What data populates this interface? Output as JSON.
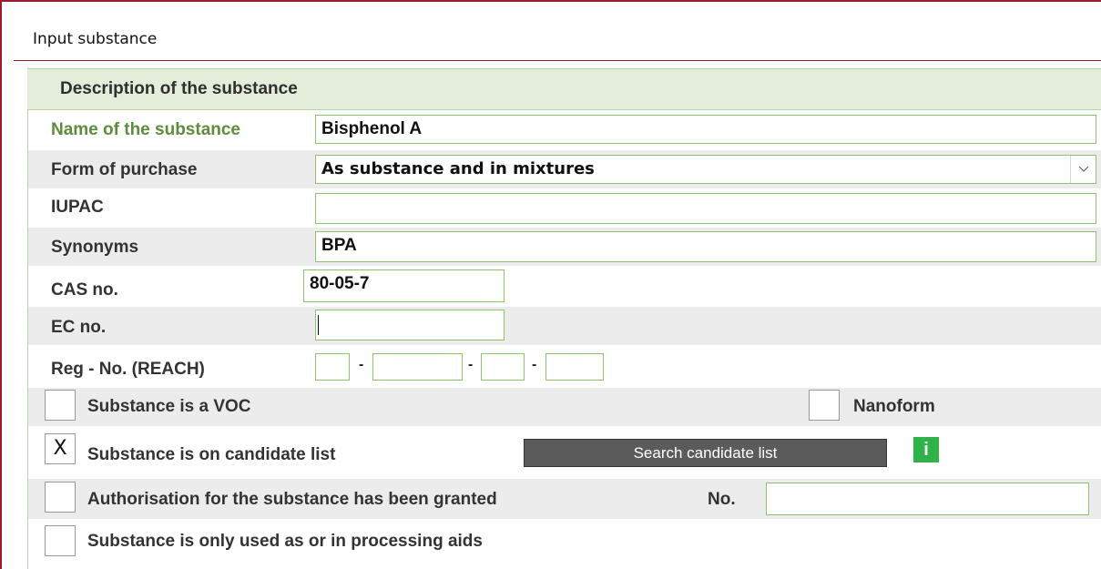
{
  "window": {
    "title": "Input substance"
  },
  "section": {
    "title": "Description of the substance"
  },
  "fields": {
    "name": {
      "label": "Name of the substance",
      "value": "Bisphenol A"
    },
    "form": {
      "label": "Form of purchase",
      "value": "As substance and in mixtures"
    },
    "iupac": {
      "label": "IUPAC",
      "value": ""
    },
    "synonyms": {
      "label": "Synonyms",
      "value": "BPA"
    },
    "cas": {
      "label": "CAS no.",
      "value": "80-05-7"
    },
    "ec": {
      "label": "EC no.",
      "value": ""
    },
    "reg": {
      "label": "Reg - No. (REACH)",
      "separator": "-",
      "parts": [
        "",
        "",
        "",
        ""
      ]
    }
  },
  "checkboxes": {
    "voc": {
      "label": "Substance is a VOC",
      "checked": false,
      "mark": ""
    },
    "nanoform": {
      "label": "Nanoform",
      "checked": false,
      "mark": ""
    },
    "candidate": {
      "label": "Substance is on candidate list",
      "checked": true,
      "mark": "X"
    },
    "authorisation": {
      "label": "Authorisation for the substance has been granted",
      "checked": false,
      "mark": ""
    },
    "processing": {
      "label": "Substance is only used as or in processing aids",
      "checked": false,
      "mark": ""
    }
  },
  "authorisation_no": {
    "label": "No.",
    "value": ""
  },
  "buttons": {
    "search_candidate": "Search candidate list"
  },
  "info": {
    "glyph": "i",
    "icon": "info-icon"
  },
  "colors": {
    "frame": "#9b1c2a",
    "header_bg": "#e3edd9",
    "field_border": "#8cc46c",
    "label_green": "#5c8c3c",
    "button_bg": "#5b5b5b",
    "info_bg": "#2fb24a"
  }
}
